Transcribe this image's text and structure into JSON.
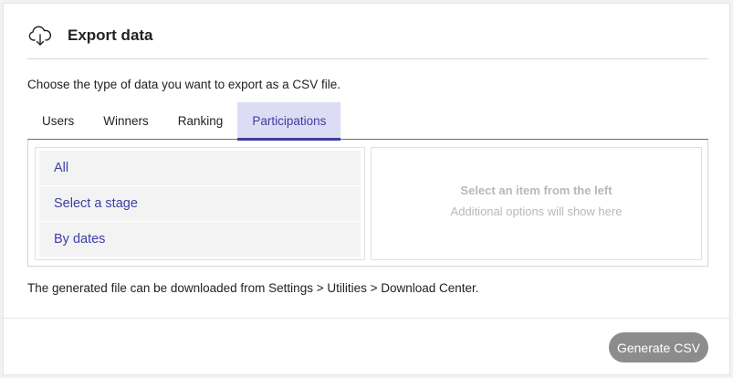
{
  "dialog": {
    "title": "Export data",
    "icon": "cloud-download-icon",
    "description": "Choose the type of data you want to export as a CSV file."
  },
  "tabs": [
    {
      "label": "Users",
      "active": false
    },
    {
      "label": "Winners",
      "active": false
    },
    {
      "label": "Ranking",
      "active": false
    },
    {
      "label": "Participations",
      "active": true
    }
  ],
  "options": [
    {
      "label": "All"
    },
    {
      "label": "Select a stage"
    },
    {
      "label": "By dates"
    }
  ],
  "placeholder": {
    "title": "Select an item from the left",
    "subtitle": "Additional options will show here"
  },
  "note": "The generated file can be downloaded from Settings > Utilities > Download Center.",
  "footer": {
    "generate_label": "Generate CSV"
  },
  "colors": {
    "accent": "#3e3e9e",
    "tab_active_bg": "#dcdcf5",
    "button_bg": "#8c8c8c"
  }
}
